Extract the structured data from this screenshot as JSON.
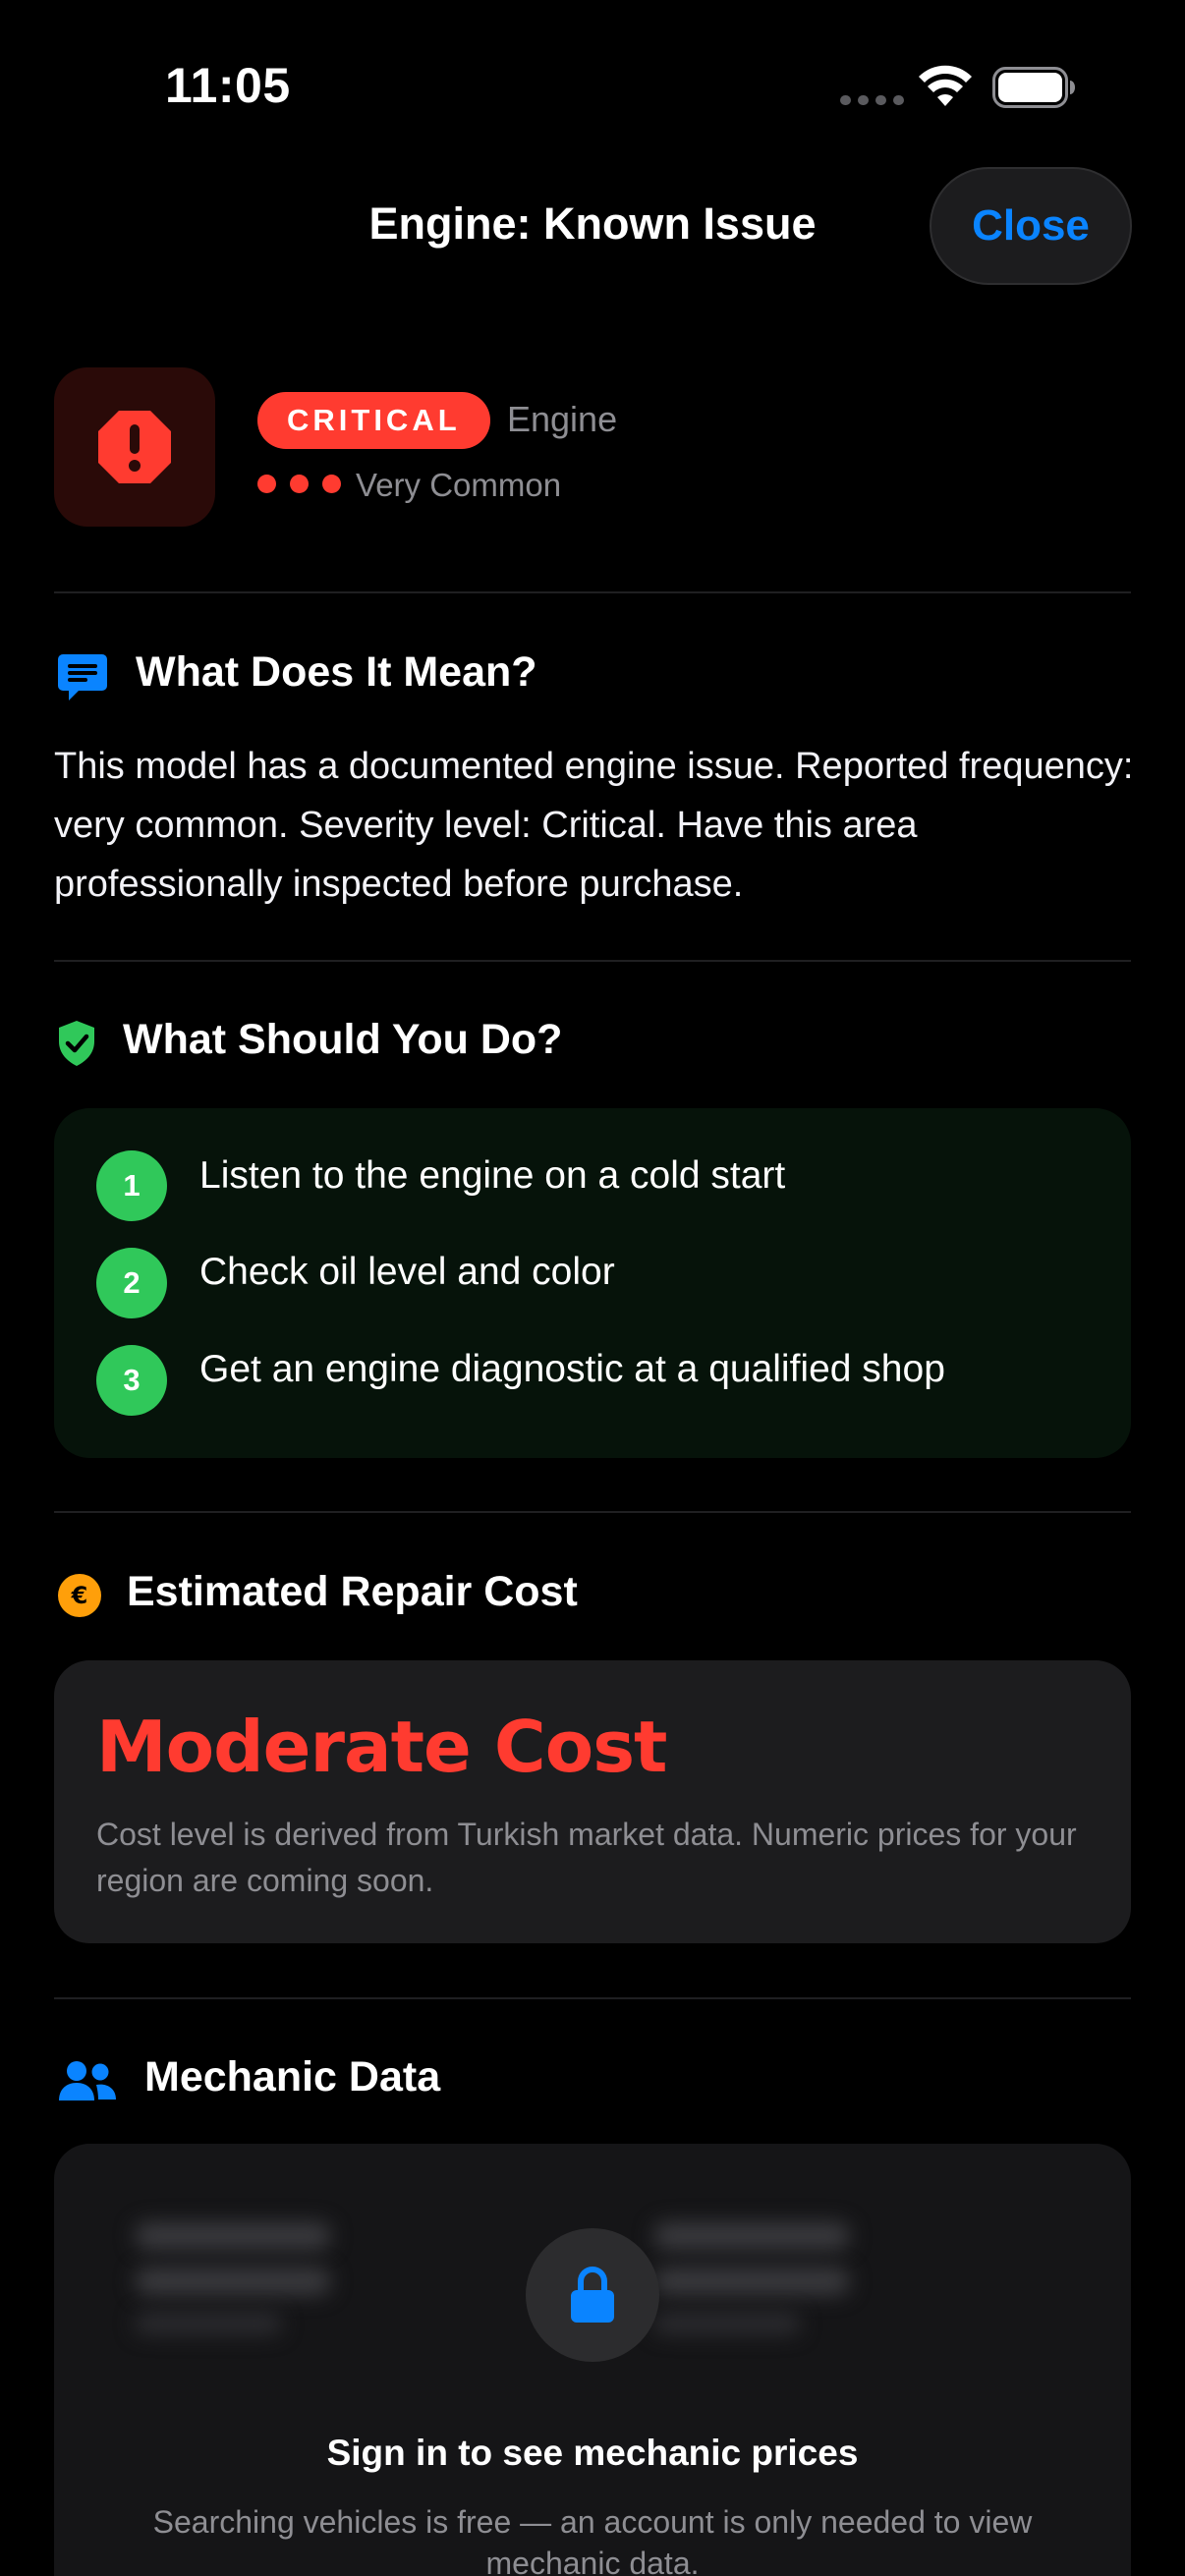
{
  "status_bar": {
    "time": "11:05"
  },
  "header": {
    "title": "Engine: Known Issue",
    "close_label": "Close"
  },
  "issue": {
    "severity": "CRITICAL",
    "category": "Engine",
    "frequency": "Very Common",
    "frequency_level": 3,
    "severity_color": "#ff3b30"
  },
  "meaning": {
    "title": "What Does It Mean?",
    "icon": "message-icon",
    "text": "This model has a documented engine issue. Reported frequency: very common. Severity level: Critical. Have this area professionally inspected before purchase."
  },
  "actions": {
    "title": "What Should You Do?",
    "icon": "shield-check-icon",
    "steps": [
      {
        "number": "1",
        "text": "Listen to the engine on a cold start"
      },
      {
        "number": "2",
        "text": "Check oil level and color"
      },
      {
        "number": "3",
        "text": "Get an engine diagnostic at a qualified shop"
      }
    ]
  },
  "cost": {
    "title": "Estimated Repair Cost",
    "icon": "euro-icon",
    "level": "Moderate Cost",
    "note": "Cost level is derived from Turkish market data. Numeric prices for your region are coming soon."
  },
  "mechanic": {
    "title": "Mechanic Data",
    "icon": "people-icon",
    "signin_title": "Sign in to see mechanic prices",
    "signin_note": "Searching vehicles is free — an account is only needed to view mechanic data."
  },
  "colors": {
    "accent": "#0a84ff",
    "critical": "#ff3b30",
    "success": "#30c85a",
    "euro": "#ff9f0a"
  }
}
